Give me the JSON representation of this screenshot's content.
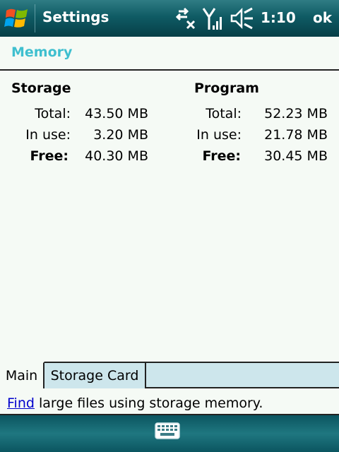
{
  "titlebar": {
    "title": "Settings",
    "time": "1:10",
    "ok_label": "ok",
    "icons": [
      "windows-start-icon",
      "connectivity-icon",
      "signal-strength-icon",
      "speaker-mute-icon"
    ]
  },
  "page": {
    "title": "Memory"
  },
  "storage": {
    "heading": "Storage",
    "rows": [
      {
        "label": "Total:",
        "value": "43.50 MB"
      },
      {
        "label": "In use:",
        "value": "3.20 MB"
      },
      {
        "label": "Free:",
        "value": "40.30 MB"
      }
    ]
  },
  "program": {
    "heading": "Program",
    "rows": [
      {
        "label": "Total:",
        "value": "52.23 MB"
      },
      {
        "label": "In use:",
        "value": "21.78 MB"
      },
      {
        "label": "Free:",
        "value": "30.45 MB"
      }
    ]
  },
  "tabs": [
    {
      "label": "Main",
      "active": true
    },
    {
      "label": "Storage Card",
      "active": false
    }
  ],
  "find": {
    "link_label": "Find",
    "text": "large files using storage memory."
  },
  "bottombar": {
    "icons": [
      "keyboard-icon"
    ]
  },
  "colors": {
    "accent": "#3fbfcf",
    "bar": "#0f5b64",
    "link": "#0000cc",
    "tab_bg": "#cde6ec"
  }
}
